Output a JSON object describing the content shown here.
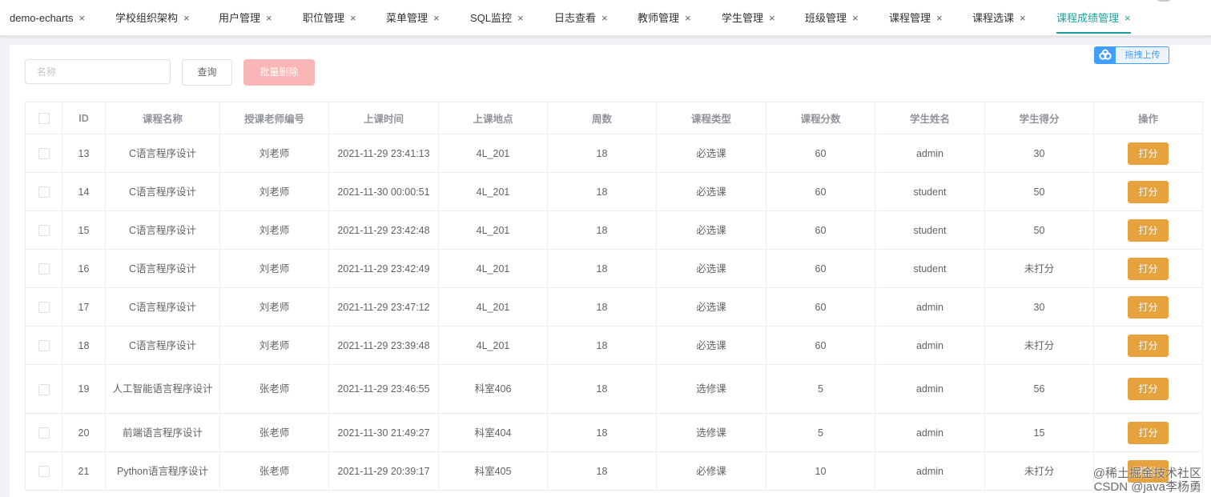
{
  "tabs": [
    {
      "label": "demo-echarts",
      "active": false
    },
    {
      "label": "学校组织架构",
      "active": false
    },
    {
      "label": "用户管理",
      "active": false
    },
    {
      "label": "职位管理",
      "active": false
    },
    {
      "label": "菜单管理",
      "active": false
    },
    {
      "label": "SQL监控",
      "active": false
    },
    {
      "label": "日志查看",
      "active": false
    },
    {
      "label": "教师管理",
      "active": false
    },
    {
      "label": "学生管理",
      "active": false
    },
    {
      "label": "班级管理",
      "active": false
    },
    {
      "label": "课程管理",
      "active": false
    },
    {
      "label": "课程选课",
      "active": false
    },
    {
      "label": "课程成绩管理",
      "active": true
    }
  ],
  "tab_close_icon": "×",
  "toolbar": {
    "search_placeholder": "名称",
    "search_value": "",
    "query_label": "查询",
    "batch_delete_label": "批量删除",
    "upload_label": "拖拽上传",
    "upload_icon": "baidu-cloud-icon"
  },
  "table": {
    "headers": [
      "ID",
      "课程名称",
      "授课老师编号",
      "上课时间",
      "上课地点",
      "周数",
      "课程类型",
      "课程分数",
      "学生姓名",
      "学生得分",
      "操作"
    ],
    "action_label": "打分",
    "rows": [
      [
        "13",
        "C语言程序设计",
        "刘老师",
        "2021-11-29 23:41:13",
        "4L_201",
        "18",
        "必选课",
        "60",
        "admin",
        "30"
      ],
      [
        "14",
        "C语言程序设计",
        "刘老师",
        "2021-11-30 00:00:51",
        "4L_201",
        "18",
        "必选课",
        "60",
        "student",
        "50"
      ],
      [
        "15",
        "C语言程序设计",
        "刘老师",
        "2021-11-29 23:42:48",
        "4L_201",
        "18",
        "必选课",
        "60",
        "student",
        "50"
      ],
      [
        "16",
        "C语言程序设计",
        "刘老师",
        "2021-11-29 23:42:49",
        "4L_201",
        "18",
        "必选课",
        "60",
        "student",
        "未打分"
      ],
      [
        "17",
        "C语言程序设计",
        "刘老师",
        "2021-11-29 23:47:12",
        "4L_201",
        "18",
        "必选课",
        "60",
        "admin",
        "30"
      ],
      [
        "18",
        "C语言程序设计",
        "刘老师",
        "2021-11-29 23:39:48",
        "4L_201",
        "18",
        "必选课",
        "60",
        "admin",
        "未打分"
      ],
      [
        "19",
        "人工智能语言程序设计",
        "张老师",
        "2021-11-29 23:46:55",
        "科室406",
        "18",
        "选修课",
        "5",
        "admin",
        "56"
      ],
      [
        "20",
        "前端语言程序设计",
        "张老师",
        "2021-11-30 21:49:27",
        "科室404",
        "18",
        "选修课",
        "5",
        "admin",
        "15"
      ],
      [
        "21",
        "Python语言程序设计",
        "张老师",
        "2021-11-29 20:39:17",
        "科室405",
        "18",
        "必修课",
        "10",
        "admin",
        "未打分"
      ]
    ]
  },
  "watermark": {
    "line1": "@稀土掘金技术社区",
    "line2": "CSDN @java李杨勇"
  },
  "colors": {
    "accent": "#20a0a0",
    "warning_button": "#e6a23c",
    "danger_disabled": "#fab6b6",
    "upload_blue": "#409eff"
  }
}
